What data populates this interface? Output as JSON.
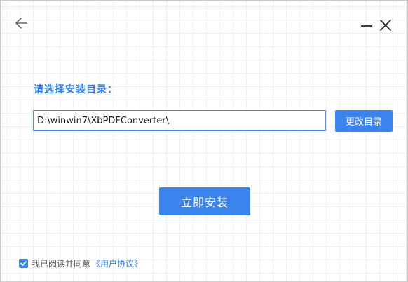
{
  "window": {
    "controls": {
      "back_icon": "arrow-left-icon",
      "minimize_icon": "minimize-icon",
      "close_icon": "close-icon"
    }
  },
  "install": {
    "directory_label": "请选择安装目录：",
    "path_value": "D:\\winwin7\\XbPDFConverter\\",
    "change_dir_label": "更改目录",
    "install_label": "立即安装"
  },
  "agreement": {
    "checked": true,
    "text": "我已阅读并同意",
    "link_label": "《用户协议》"
  },
  "colors": {
    "accent": "#3b84ee",
    "label_blue": "#2d7ff0",
    "input_border": "#4d90f0",
    "grid_line": "#eef0f3"
  }
}
